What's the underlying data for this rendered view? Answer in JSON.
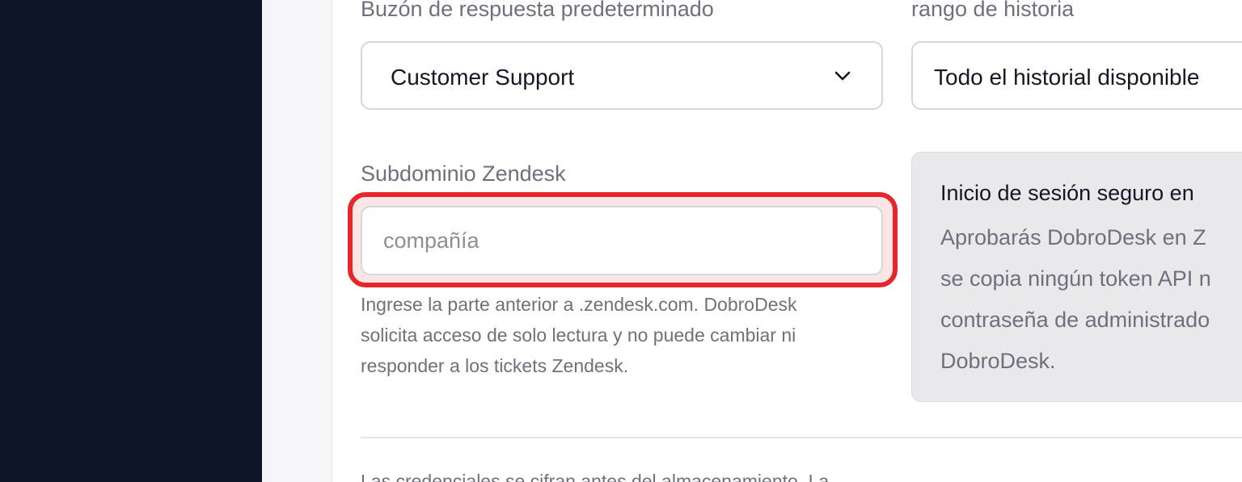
{
  "form": {
    "reply_mailbox": {
      "label": "Buzón de respuesta predeterminado",
      "value": "Customer Support",
      "icon": "chevron-down-icon"
    },
    "history_range": {
      "label": "rango de historia",
      "value": "Todo el historial disponible"
    },
    "subdomain": {
      "label": "Subdominio Zendesk",
      "placeholder": "compañía",
      "value": "",
      "help_lines": [
        "Ingrese la parte anterior a .zendesk.com. DobroDesk",
        "solicita acceso de solo lectura y no puede cambiar ni",
        "responder a los tickets Zendesk."
      ],
      "highlight_color": "#e5262b"
    },
    "secure_login": {
      "title": "Inicio de sesión seguro en",
      "body_lines": [
        "Aprobarás DobroDesk en Z",
        "se copia ningún token API n",
        "contraseña de administrado",
        "DobroDesk."
      ]
    },
    "footer": {
      "text": "Las credenciales se cifran antes del almacenamiento. La"
    }
  },
  "colors": {
    "sidebar": "#0e1427",
    "panel": "#ffffff",
    "accent_highlight": "#e5262b"
  }
}
